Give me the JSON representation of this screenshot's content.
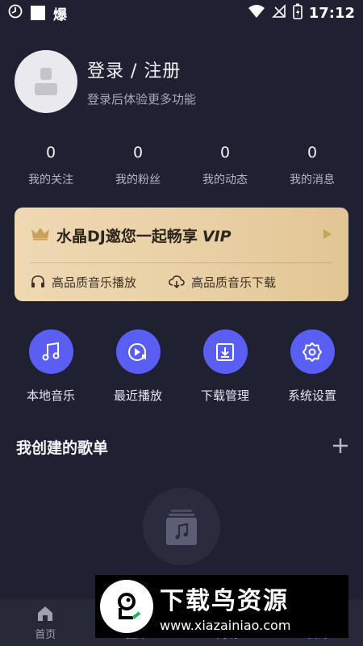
{
  "status_bar": {
    "carrier_text": "爆",
    "time": "17:12"
  },
  "profile": {
    "title": "登录 / 注册",
    "subtitle": "登录后体验更多功能"
  },
  "stats": [
    {
      "value": "0",
      "label": "我的关注"
    },
    {
      "value": "0",
      "label": "我的粉丝"
    },
    {
      "value": "0",
      "label": "我的动态"
    },
    {
      "value": "0",
      "label": "我的消息"
    }
  ],
  "vip": {
    "title": "水晶DJ邀您一起畅享",
    "vip_word": "VIP",
    "feature_1": "高品质音乐播放",
    "feature_2": "高品质音乐下载"
  },
  "quick_actions": [
    {
      "label": "本地音乐",
      "icon": "music-note-icon"
    },
    {
      "label": "最近播放",
      "icon": "recent-play-icon"
    },
    {
      "label": "下载管理",
      "icon": "download-icon"
    },
    {
      "label": "系统设置",
      "icon": "gear-icon"
    }
  ],
  "playlist": {
    "title": "我创建的歌单"
  },
  "bottom_nav": [
    {
      "label": "首页"
    },
    {
      "label": "曲库"
    },
    {
      "label": "离线"
    },
    {
      "label": "我的"
    }
  ],
  "watermark": {
    "title": "下载鸟资源",
    "url": "www.xiazainiao.com"
  },
  "colors": {
    "background": "#1f2132",
    "accent": "#5a5ef2",
    "vip_gold": "#e8cfa4"
  }
}
